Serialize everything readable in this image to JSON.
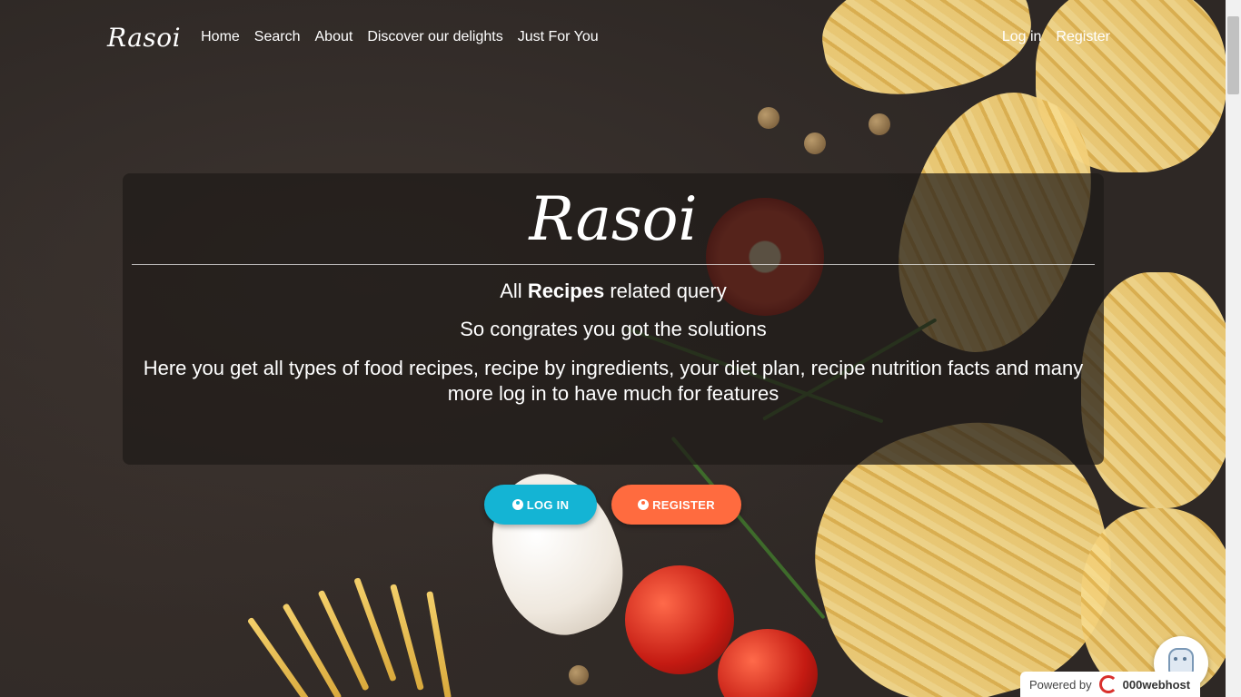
{
  "nav": {
    "brand": "Rasoi",
    "links": [
      "Home",
      "Search",
      "About",
      "Discover our delights",
      "Just For You"
    ],
    "login": "Log in",
    "register": "Register"
  },
  "hero": {
    "title": "Rasoi",
    "line1_pre": "All ",
    "line1_bold": "Recipes",
    "line1_post": " related query",
    "line2": "So congrates you got the solutions",
    "line3": "Here you get all types of food recipes, recipe by ingredients, your diet plan, recipe nutrition facts and many more log in to have much for features"
  },
  "buttons": {
    "login": "LOG IN",
    "register": "REGISTER"
  },
  "badge": {
    "powered": "Powered by",
    "host": "000webhost"
  },
  "colors": {
    "login_button": "#14b4d4",
    "register_button": "#ff6b3f"
  },
  "icons": [
    "user-circle-icon",
    "user-circle-icon",
    "webhost-logo-icon",
    "chat-bot-icon"
  ]
}
